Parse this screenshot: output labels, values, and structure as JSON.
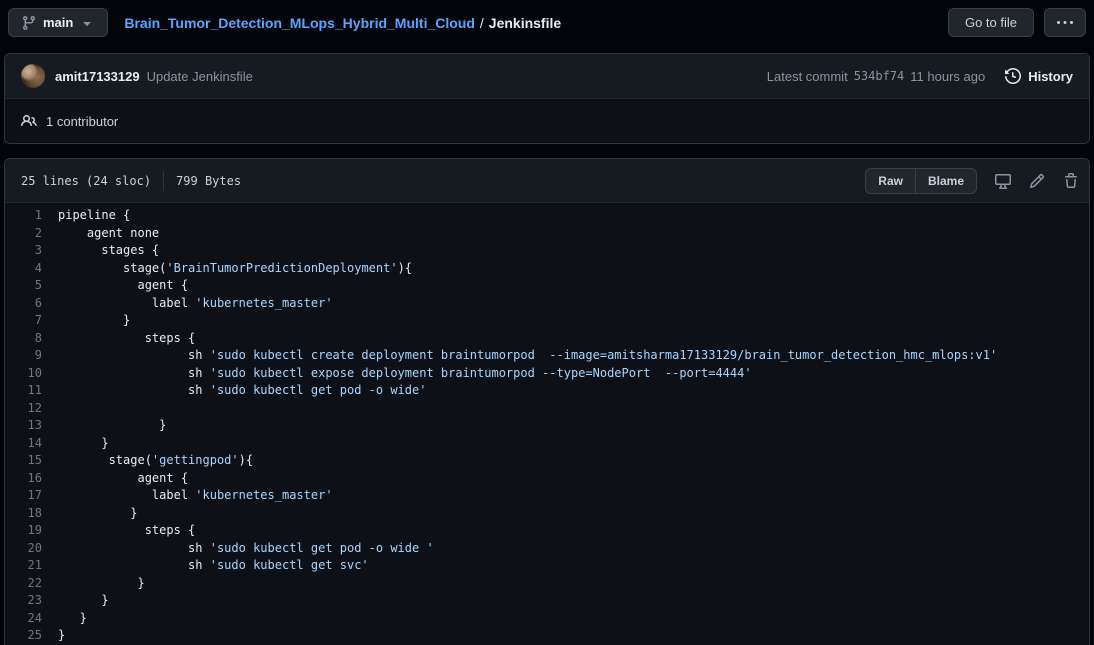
{
  "top_bar": {
    "branch": "main",
    "repo": "Brain_Tumor_Detection_MLops_Hybrid_Multi_Cloud",
    "separator": "/",
    "file": "Jenkinsfile",
    "go_to_file": "Go to file"
  },
  "commit_bar": {
    "author": "amit17133129",
    "message": "Update Jenkinsfile",
    "latest_commit_label": "Latest commit",
    "sha": "534bf74",
    "time": "11 hours ago",
    "history": "History"
  },
  "contributors": {
    "label": "1 contributor"
  },
  "file_header": {
    "lines_info": "25 lines (24 sloc)",
    "size": "799 Bytes",
    "raw": "Raw",
    "blame": "Blame"
  },
  "colors": {
    "page_bg": "#010409",
    "box_bg": "#0d1117",
    "header_bg": "#161b22",
    "border": "#30363d",
    "link_blue": "#58a6ff",
    "code_plain": "#e6edf3",
    "code_string": "#a5d6ff",
    "line_number": "#6e7681",
    "muted_text": "#8b949e"
  },
  "icons": [
    "git-branch-icon",
    "chevron-down-icon",
    "kebab-horizontal-icon",
    "history-clock-icon",
    "people-icon",
    "device-desktop-icon",
    "pencil-icon",
    "trash-icon"
  ],
  "code": {
    "lines": [
      {
        "n": 1,
        "segs": [
          {
            "t": "pipeline {",
            "c": "p"
          }
        ]
      },
      {
        "n": 2,
        "segs": [
          {
            "t": "    agent none",
            "c": "p"
          }
        ]
      },
      {
        "n": 3,
        "segs": [
          {
            "t": "      stages {",
            "c": "p"
          }
        ]
      },
      {
        "n": 4,
        "segs": [
          {
            "t": "         stage(",
            "c": "p"
          },
          {
            "t": "'BrainTumorPredictionDeployment'",
            "c": "s"
          },
          {
            "t": "){",
            "c": "p"
          }
        ]
      },
      {
        "n": 5,
        "segs": [
          {
            "t": "           agent {",
            "c": "p"
          }
        ]
      },
      {
        "n": 6,
        "segs": [
          {
            "t": "             label ",
            "c": "p"
          },
          {
            "t": "'kubernetes_master'",
            "c": "s"
          }
        ]
      },
      {
        "n": 7,
        "segs": [
          {
            "t": "         }",
            "c": "p"
          }
        ]
      },
      {
        "n": 8,
        "segs": [
          {
            "t": "            steps {",
            "c": "p"
          }
        ]
      },
      {
        "n": 9,
        "segs": [
          {
            "t": "                  sh ",
            "c": "p"
          },
          {
            "t": "'sudo kubectl create deployment braintumorpod  --image=amitsharma17133129/brain_tumor_detection_hmc_mlops:v1'",
            "c": "s"
          }
        ]
      },
      {
        "n": 10,
        "segs": [
          {
            "t": "                  sh ",
            "c": "p"
          },
          {
            "t": "'sudo kubectl expose deployment braintumorpod --type=NodePort  --port=4444'",
            "c": "s"
          }
        ]
      },
      {
        "n": 11,
        "segs": [
          {
            "t": "                  sh ",
            "c": "p"
          },
          {
            "t": "'sudo kubectl get pod -o wide'",
            "c": "s"
          }
        ]
      },
      {
        "n": 12,
        "segs": []
      },
      {
        "n": 13,
        "segs": [
          {
            "t": "              }",
            "c": "p"
          }
        ]
      },
      {
        "n": 14,
        "segs": [
          {
            "t": "      }",
            "c": "p"
          }
        ]
      },
      {
        "n": 15,
        "segs": [
          {
            "t": "       stage(",
            "c": "p"
          },
          {
            "t": "'gettingpod'",
            "c": "s"
          },
          {
            "t": "){",
            "c": "p"
          }
        ]
      },
      {
        "n": 16,
        "segs": [
          {
            "t": "           agent {",
            "c": "p"
          }
        ]
      },
      {
        "n": 17,
        "segs": [
          {
            "t": "             label ",
            "c": "p"
          },
          {
            "t": "'kubernetes_master'",
            "c": "s"
          }
        ]
      },
      {
        "n": 18,
        "segs": [
          {
            "t": "          }",
            "c": "p"
          }
        ]
      },
      {
        "n": 19,
        "segs": [
          {
            "t": "            steps {",
            "c": "p"
          }
        ]
      },
      {
        "n": 20,
        "segs": [
          {
            "t": "                  sh ",
            "c": "p"
          },
          {
            "t": "'sudo kubectl get pod -o wide '",
            "c": "s"
          }
        ]
      },
      {
        "n": 21,
        "segs": [
          {
            "t": "                  sh ",
            "c": "p"
          },
          {
            "t": "'sudo kubectl get svc'",
            "c": "s"
          }
        ]
      },
      {
        "n": 22,
        "segs": [
          {
            "t": "           }",
            "c": "p"
          }
        ]
      },
      {
        "n": 23,
        "segs": [
          {
            "t": "      }",
            "c": "p"
          }
        ]
      },
      {
        "n": 24,
        "segs": [
          {
            "t": "   }",
            "c": "p"
          }
        ]
      },
      {
        "n": 25,
        "segs": [
          {
            "t": "}",
            "c": "p"
          }
        ]
      }
    ]
  }
}
